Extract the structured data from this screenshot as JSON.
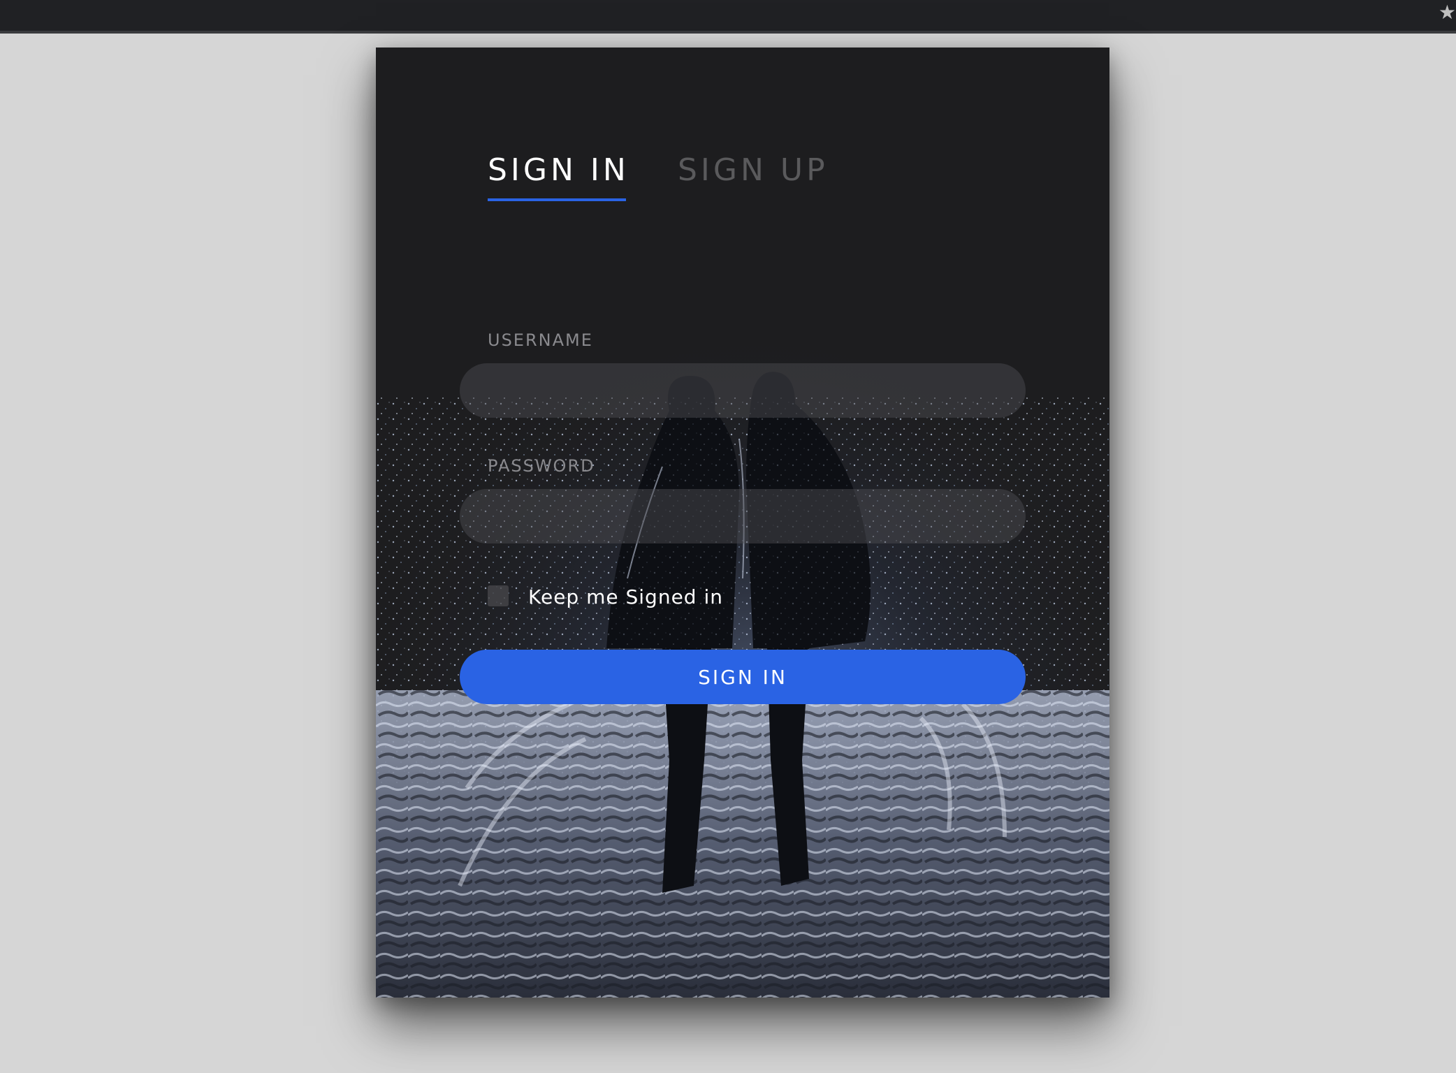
{
  "colors": {
    "page_background": "#d6d6d6",
    "card_background": "#1d1d1f",
    "accent": "#2a63e4",
    "active_tab_text": "#ffffff",
    "inactive_tab_text": "#5a5a5c",
    "label_text": "#8a8a8e"
  },
  "browser": {
    "star_icon": "star-icon"
  },
  "tabs": [
    {
      "label": "SIGN IN",
      "active": true
    },
    {
      "label": "SIGN UP",
      "active": false
    }
  ],
  "form": {
    "username_label": "USERNAME",
    "username_value": "",
    "password_label": "PASSWORD",
    "password_value": "",
    "keep_signed_in_label": "Keep me Signed in",
    "keep_signed_in_checked": false,
    "submit_label": "SIGN IN"
  }
}
